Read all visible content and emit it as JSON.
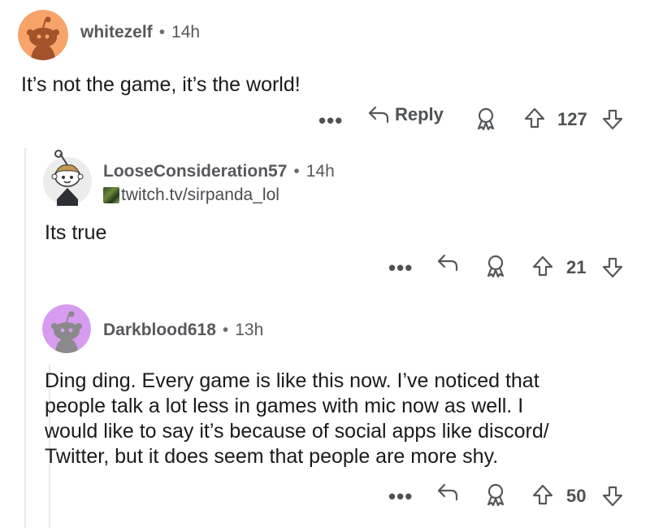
{
  "comments": [
    {
      "username": "whitezelf",
      "separator": "•",
      "time": "14h",
      "body": "It’s not the game, it’s the world!",
      "actions": {
        "more": "•••",
        "reply": "Reply",
        "score": "127"
      },
      "avatar_color": "#f7a36a"
    },
    {
      "username": "LooseConsideration57",
      "separator": "•",
      "time": "14h",
      "flair": "twitch.tv/sirpanda_lol",
      "body": "Its true",
      "actions": {
        "more": "•••",
        "score": "21"
      },
      "avatar_color": "#e8e8e8"
    },
    {
      "username": "Darkblood618",
      "separator": "•",
      "time": "13h",
      "body_lines": [
        "Ding ding. Every game is like this now. I’ve noticed that",
        "people talk a lot less in games with mic now as well. I",
        "would like to say it’s because of social apps like discord/",
        "Twitter, but it does seem that people are more shy."
      ],
      "actions": {
        "more": "•••",
        "score": "50"
      },
      "avatar_color": "#d79cf0"
    }
  ],
  "icons": {
    "reply": "reply-arrow-icon",
    "award": "award-icon",
    "upvote": "upvote-arrow-icon",
    "downvote": "downvote-arrow-icon",
    "more": "more-options-icon"
  }
}
